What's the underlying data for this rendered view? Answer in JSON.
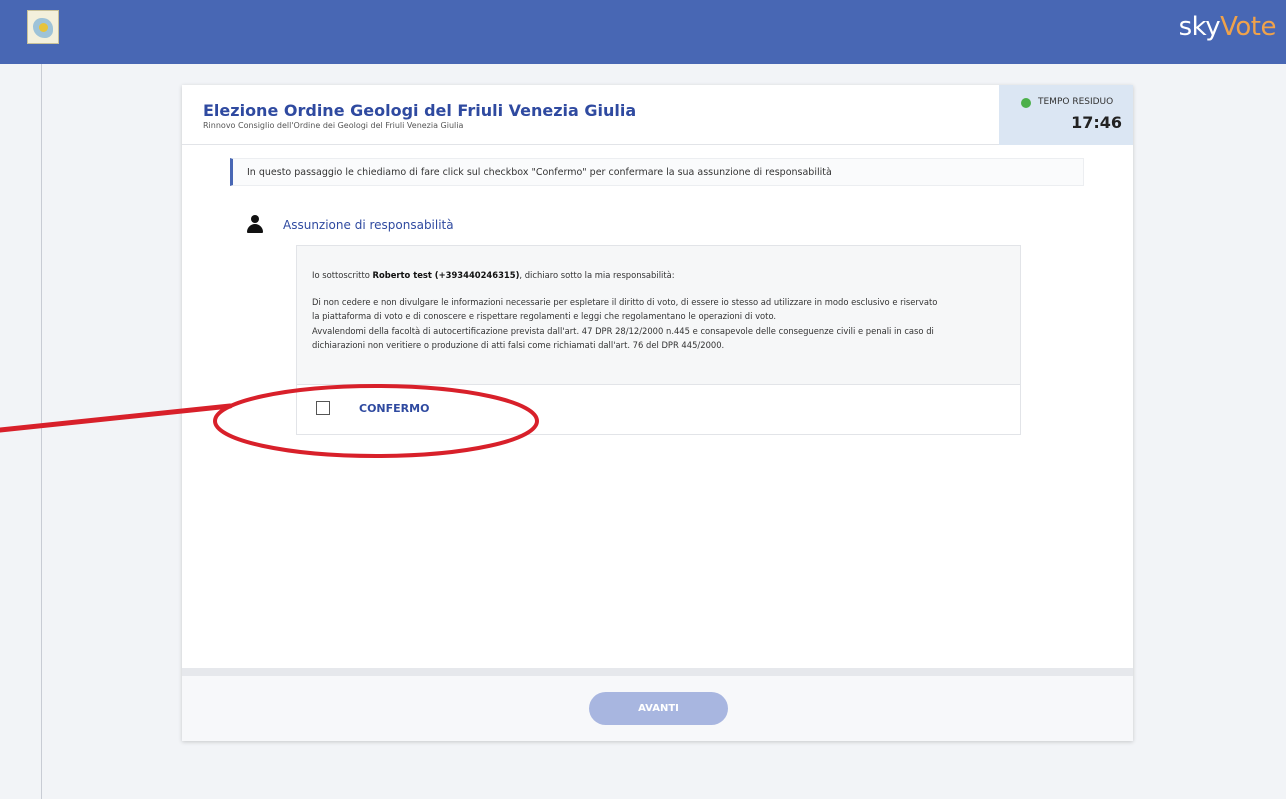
{
  "header": {
    "brand_sky": "sky",
    "brand_vote": "Vote"
  },
  "election": {
    "title": "Elezione Ordine Geologi del Friuli Venezia Giulia",
    "subtitle": "Rinnovo Consiglio dell'Ordine dei Geologi del Friuli Venezia Giulia"
  },
  "timer": {
    "label": "TEMPO RESIDUO",
    "value": "17:46",
    "status_color": "#4cb04a"
  },
  "info_message": "In questo passaggio le chiediamo di fare click sul checkbox \"Confermo\" per confermare la sua assunzione di responsabilità",
  "section": {
    "title": "Assunzione di responsabilità",
    "icon": "user-icon"
  },
  "declaration": {
    "intro_prefix": "Io sottoscritto ",
    "name": "Roberto test (+393440246315)",
    "intro_suffix": ", dichiaro sotto la mia responsabilità:",
    "line1": "Di non cedere e non divulgare le informazioni necessarie per espletare il diritto di voto, di essere io stesso ad utilizzare in modo esclusivo e riservato",
    "line2": "la piattaforma di voto e di conoscere e rispettare regolamenti e leggi che regolamentano le operazioni di voto.",
    "line3": "Avvalendomi della facoltà di autocertificazione prevista dall'art. 47 DPR 28/12/2000 n.445 e consapevole delle conseguenze civili e penali in caso di",
    "line4": "dichiarazioni non veritiere o produzione di atti falsi come richiamati dall'art. 76 del DPR 445/2000."
  },
  "confirm": {
    "label": "CONFERMO",
    "checked": false
  },
  "footer": {
    "next_label": "AVANTI"
  },
  "colors": {
    "topbar": "#4867b4",
    "accent": "#2f4aa0",
    "annotation": "#d8202a",
    "button_disabled": "#a8b6e0"
  }
}
